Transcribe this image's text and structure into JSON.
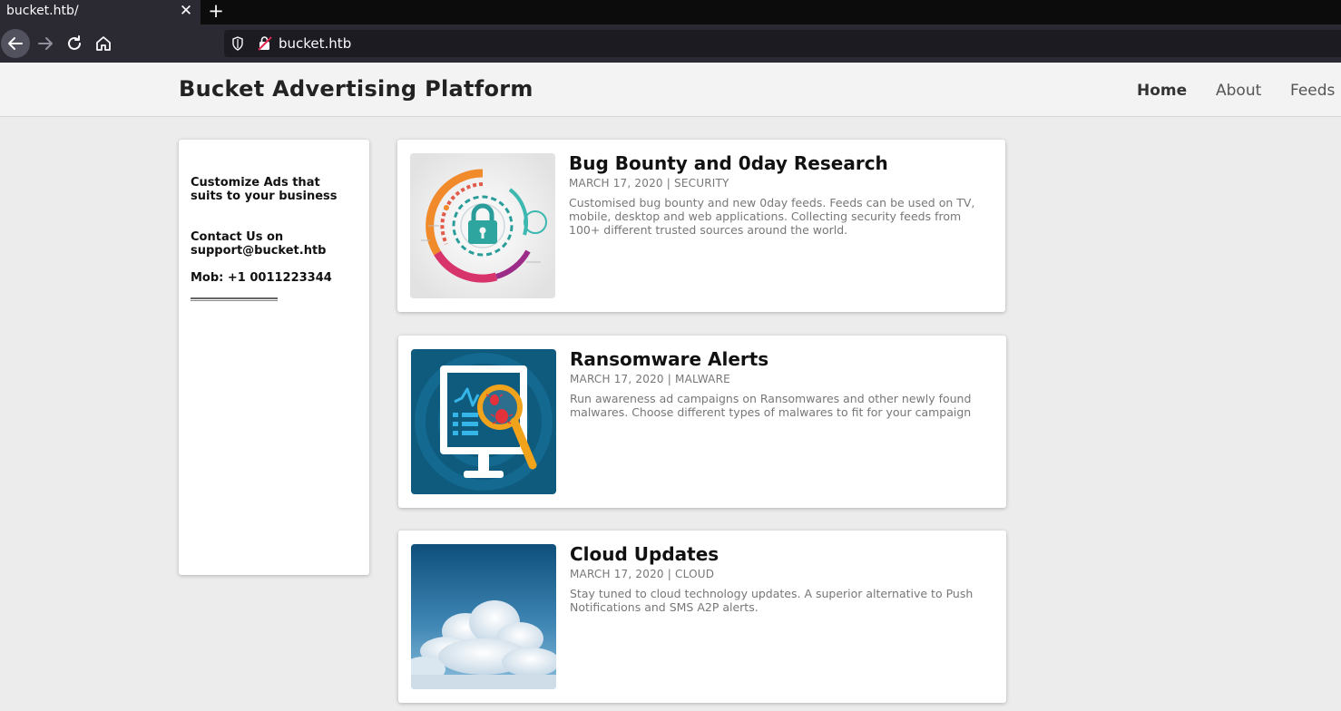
{
  "browser": {
    "tab_title": "bucket.htb/",
    "tab_close": "✕",
    "new_tab": "+",
    "url": "bucket.htb"
  },
  "site": {
    "title": "Bucket Advertising Platform",
    "nav": [
      {
        "label": "Home",
        "active": true
      },
      {
        "label": "About",
        "active": false
      },
      {
        "label": "Feeds",
        "active": false
      }
    ]
  },
  "sidebar": {
    "tagline": "Customize Ads that suits to your business",
    "contact": "Contact Us on support@bucket.htb",
    "mobile": "Mob: +1 0011223344"
  },
  "posts": [
    {
      "title": "Bug Bounty and 0day Research",
      "meta": "MARCH 17, 2020 | SECURITY",
      "description": "Customised bug bounty and new 0day feeds. Feeds can be used on TV, mobile, desktop and web applications. Collecting security feeds from 100+ different trusted sources around the world.",
      "image_icon": "security-lock-image"
    },
    {
      "title": "Ransomware Alerts",
      "meta": "MARCH 17, 2020 | MALWARE",
      "description": "Run awareness ad campaigns on Ransomwares and other newly found malwares. Choose different types of malwares to fit for your campaign",
      "image_icon": "malware-scan-image"
    },
    {
      "title": "Cloud Updates",
      "meta": "MARCH 17, 2020 | CLOUD",
      "description": "Stay tuned to cloud technology updates. A superior alternative to Push Notifications and SMS A2P alerts.",
      "image_icon": "cloud-sky-image"
    }
  ],
  "colors": {
    "page_bg": "#ececec",
    "header_bg": "#f3f3f3",
    "chrome_bg": "#2b2a33"
  }
}
